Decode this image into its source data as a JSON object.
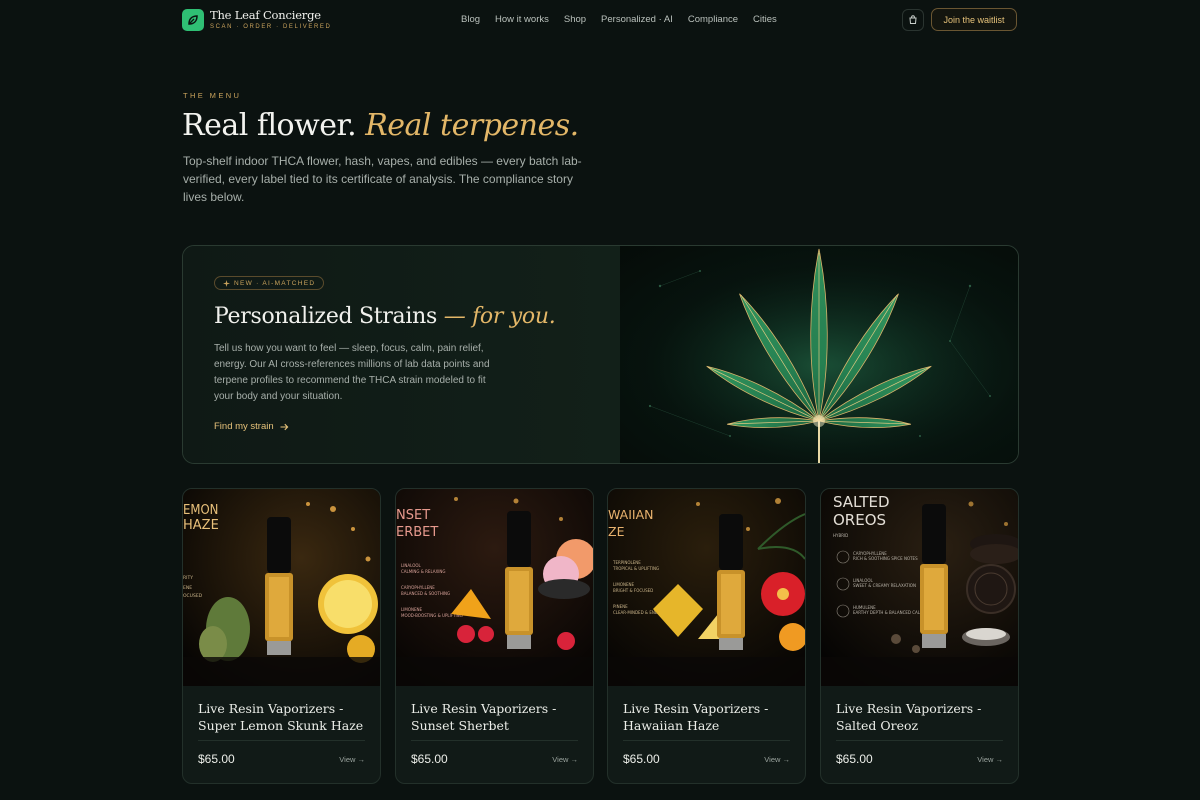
{
  "brand": {
    "name": "The Leaf Concierge",
    "tagline": "SCAN · ORDER · DELIVERED",
    "mark_color": "#2fbf74"
  },
  "nav": {
    "links": [
      "Blog",
      "How it works",
      "Shop",
      "Personalized · AI",
      "Compliance",
      "Cities"
    ],
    "cart_icon": "cart-icon",
    "waitlist_label": "Join the waitlist"
  },
  "hero": {
    "eyebrow": "THE MENU",
    "title_main": "Real flower.",
    "title_accent": "Real terpenes.",
    "lede": "Top-shelf indoor THCA flower, hash, vapes, and edibles — every batch lab-verified, every label tied to its certificate of analysis. The compliance story lives below."
  },
  "feature": {
    "badge": "NEW · AI-MATCHED",
    "title_main": "Personalized Strains",
    "title_accent": "— for you.",
    "copy": "Tell us how you want to feel — sleep, focus, calm, pain relief, energy. Our AI cross-references millions of lab data points and terpene profiles to recommend the THCA strain modeled to fit your body and your situation.",
    "cta": "Find my strain",
    "accent_color": "#e3b768"
  },
  "products": [
    {
      "name": "Live Resin Vaporizers - Super Lemon Skunk Haze",
      "price": "$65.00",
      "view": "View →",
      "art_title": [
        "EMON",
        "HAZE"
      ],
      "art_notes": [
        "RITY",
        "ENE",
        "OCUSED"
      ],
      "art_color": "#e8c07a"
    },
    {
      "name": "Live Resin Vaporizers - Sunset Sherbet",
      "price": "$65.00",
      "view": "View →",
      "art_title": [
        "NSET",
        "ERBET"
      ],
      "art_notes": [
        "LINALOOL",
        "CALMING & RELAXING",
        "CARYOPHYLLENE",
        "BALANCED & SOOTHING",
        "LIMONENE",
        "MOOD-BOOSTING & UPLIFTING"
      ],
      "art_color": "#e79a8e"
    },
    {
      "name": "Live Resin Vaporizers - Hawaiian Haze",
      "price": "$65.00",
      "view": "View →",
      "art_title": [
        "WAIIAN",
        "ZE"
      ],
      "art_notes": [
        "TERPINOLENE",
        "TROPICAL & UPLIFTING",
        "LIMONENE",
        "BRIGHT & FOCUSED",
        "PINENE",
        "CLEAR-MINDED & ENERGIZING"
      ],
      "art_color": "#e8b26e"
    },
    {
      "name": "Live Resin Vaporizers - Salted Oreoz",
      "price": "$65.00",
      "view": "View →",
      "art_title": [
        "SALTED",
        "OREOS"
      ],
      "art_notes": [
        "HYBRID",
        "CARYOPHYLLENE",
        "RICH & SOOTHING SPICE NOTES",
        "LINALOOL",
        "SWEET & CREAMY RELAXATION",
        "HUMULENE",
        "EARTHY DEPTH & BALANCED CALM"
      ],
      "art_color": "#e3ded6"
    }
  ]
}
